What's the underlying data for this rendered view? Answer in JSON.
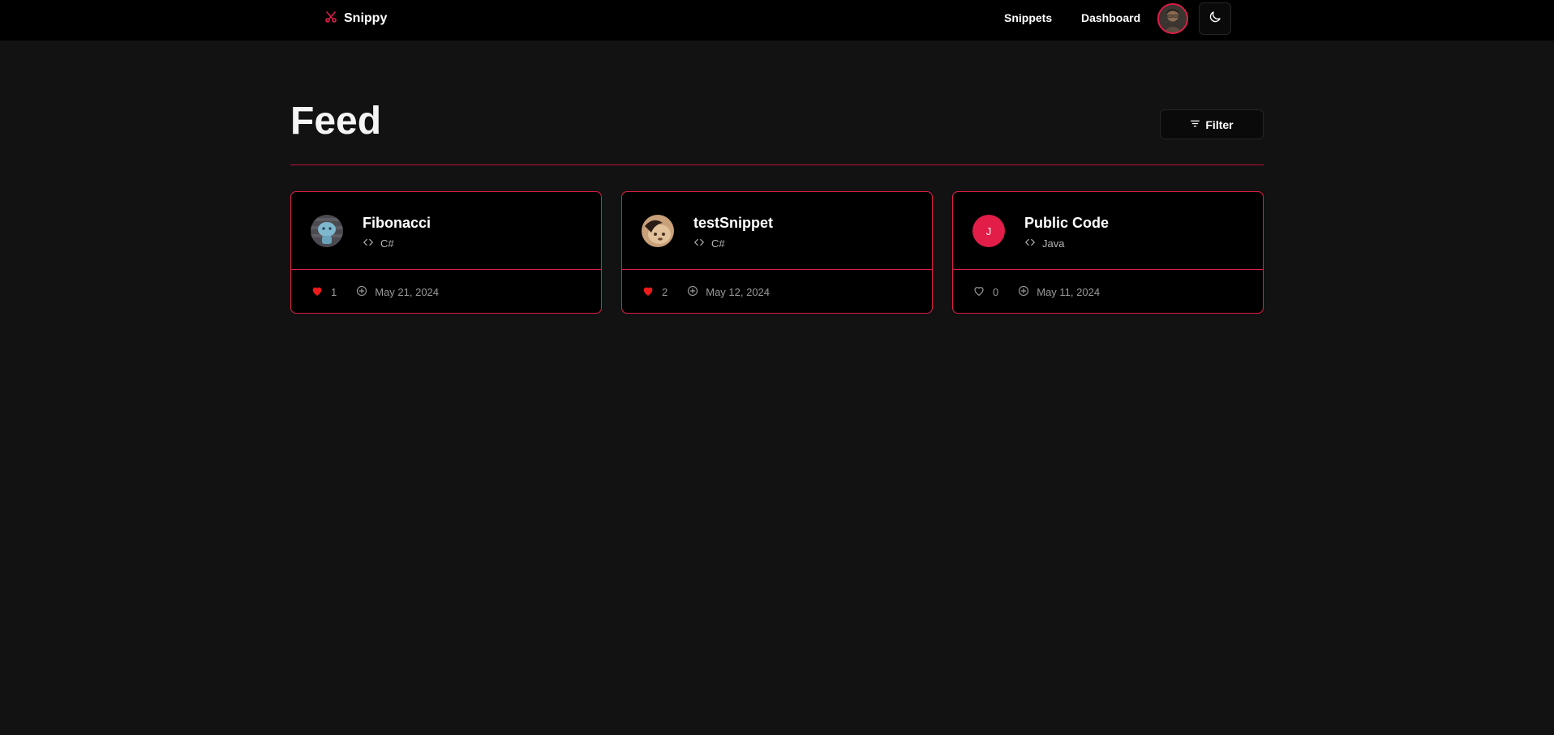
{
  "nav": {
    "brand": "Snippy",
    "brand_icon": "scissors-icon",
    "links": [
      "Snippets",
      "Dashboard"
    ],
    "avatar_icon": "user-avatar",
    "theme_icon": "moon-icon"
  },
  "page": {
    "title": "Feed",
    "filter_label": "Filter",
    "filter_icon": "filter-lines-icon"
  },
  "cards": [
    {
      "title": "Fibonacci",
      "language": "C#",
      "likes": "1",
      "liked": true,
      "date": "May 21, 2024",
      "avatar_type": "image",
      "avatar_initial": ""
    },
    {
      "title": "testSnippet",
      "language": "C#",
      "likes": "2",
      "liked": true,
      "date": "May 12, 2024",
      "avatar_type": "image",
      "avatar_initial": ""
    },
    {
      "title": "Public Code",
      "language": "Java",
      "likes": "0",
      "liked": false,
      "date": "May 11, 2024",
      "avatar_type": "initial",
      "avatar_initial": "J"
    }
  ],
  "colors": {
    "accent": "#e11d48",
    "background": "#121212",
    "navbar": "#000000",
    "like_active": "#ef1a1a"
  }
}
